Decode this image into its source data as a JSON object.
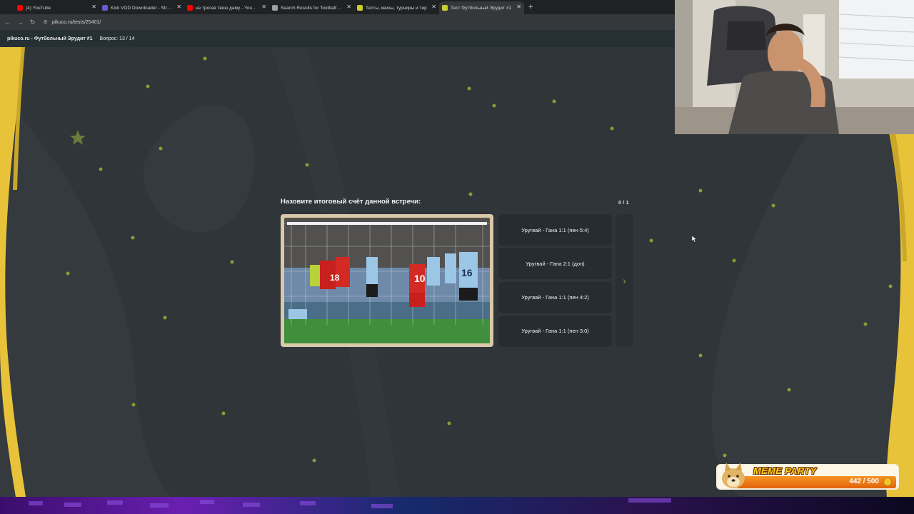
{
  "browser": {
    "tabs": [
      {
        "title": "(4) YouTube",
        "favicon_color": "#ff0000",
        "active": false
      },
      {
        "title": "Kick VOD Downloader - Stream",
        "favicon_color": "#6a5acd",
        "active": false
      },
      {
        "title": "не трогая твою даму - YouTube",
        "favicon_color": "#ff0000",
        "active": false
      },
      {
        "title": "Search Results for 'football' - T",
        "favicon_color": "#9aa0a6",
        "active": false
      },
      {
        "title": "Тесты, квизы, турниры и тир",
        "favicon_color": "#c8d02e",
        "active": false
      },
      {
        "title": "Тест Футбольный Эрудит #1",
        "favicon_color": "#c8d02e",
        "active": true
      }
    ],
    "new_tab": "+",
    "url": "pikuco.ru/tests/25401/"
  },
  "site": {
    "brand": "pikuco.ru - Футбольный Эрудит #1",
    "progress": "Вопрос: 13 / 14"
  },
  "quiz": {
    "question": "Назовите итоговый счёт данной встречи:",
    "score": "0 / 1",
    "answers": [
      "Уругвай - Гана 1:1 (пен 5:4)",
      "Уругвай - Гана 2:1 (доп)",
      "Уругвай - Гана 1:1 (пен 4:2)",
      "Уругвай - Гана 1:1 (пен 3:0)"
    ],
    "next_icon": "chevron-right-icon"
  },
  "widget": {
    "title": "MEME PARTY",
    "count": "442 / 500"
  },
  "colors": {
    "background": "#2f3538",
    "accent_yellow": "#e8c33a",
    "answer_bg": "#262d30"
  }
}
